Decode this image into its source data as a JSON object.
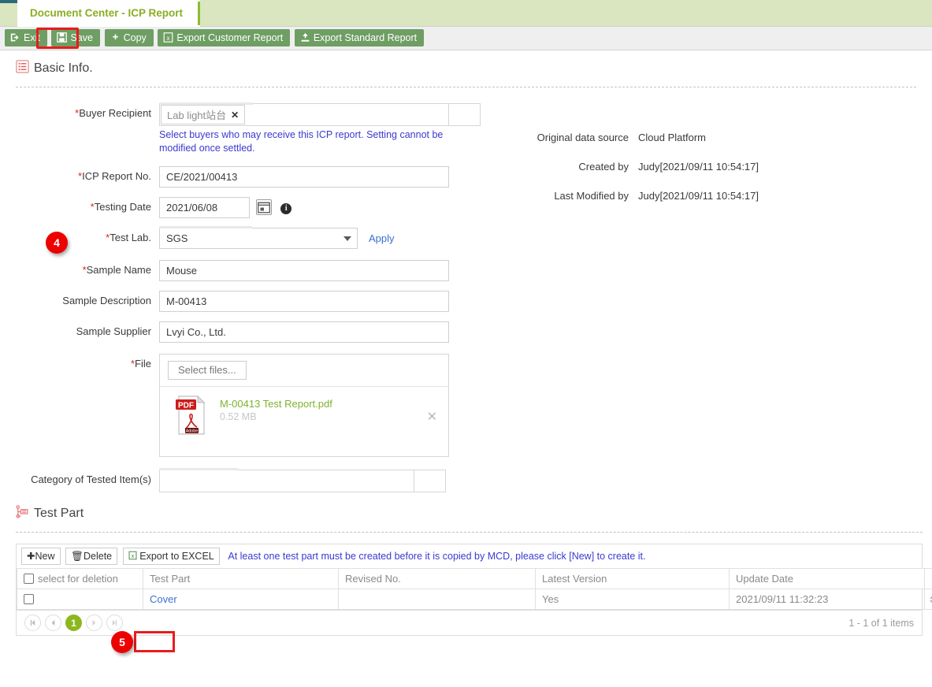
{
  "tab": {
    "title": "Document Center - ICP Report"
  },
  "toolbar": {
    "exit": "Exit",
    "save": "Save",
    "copy": "Copy",
    "export_customer": "Export Customer Report",
    "export_standard": "Export Standard Report"
  },
  "basic_info": {
    "heading": "Basic Info.",
    "buyer_recipient": {
      "label": "Buyer Recipient",
      "required": true,
      "token": "Lab light站台",
      "hint": "Select buyers who may receive this ICP report. Setting cannot be modified once settled."
    },
    "icp_report_no": {
      "label": "ICP Report No.",
      "required": true,
      "value": "CE/2021/00413"
    },
    "testing_date": {
      "label": "Testing Date",
      "required": true,
      "value": "2021/06/08"
    },
    "test_lab": {
      "label": "Test Lab.",
      "required": true,
      "value": "SGS",
      "apply_link": "Apply"
    },
    "sample_name": {
      "label": "Sample Name",
      "required": true,
      "value": "Mouse"
    },
    "sample_description": {
      "label": "Sample Description",
      "required": false,
      "value": "M-00413"
    },
    "sample_supplier": {
      "label": "Sample Supplier",
      "required": false,
      "value": "Lvyi Co., Ltd."
    },
    "file": {
      "label": "File",
      "required": true,
      "select_files": "Select files...",
      "attachment_name": "M-00413 Test Report.pdf",
      "attachment_size": "0.52 MB",
      "icon_label": "PDF",
      "icon_sublabel": "Adobe"
    },
    "category_of_tested_items": {
      "label": "Category of Tested Item(s)",
      "required": false,
      "value": ""
    }
  },
  "meta": [
    {
      "label": "Original data source",
      "value": "Cloud Platform"
    },
    {
      "label": "Created by",
      "value": "Judy[2021/09/11 10:54:17]"
    },
    {
      "label": "Last Modified by",
      "value": "Judy[2021/09/11 10:54:17]"
    }
  ],
  "test_part": {
    "heading": "Test Part",
    "toolbar": {
      "new": "New",
      "delete": "Delete",
      "export_excel": "Export to EXCEL",
      "note": "At least one test part must be created before it is copied by MCD, please click [New] to create it."
    },
    "columns": [
      "select for deletion",
      "Test Part",
      "Revised No.",
      "Latest Version",
      "Update Date"
    ],
    "rows": [
      {
        "test_part": "Cover",
        "revised_no": "",
        "latest_version": "Yes",
        "update_date": "2021/09/11 11:32:23"
      }
    ],
    "pager": {
      "first": "|◀",
      "prev": "◀",
      "current": "1",
      "next": "▶",
      "last": "▶|",
      "items": "1 - 1 of 1 items"
    }
  },
  "annotations": {
    "step4": "4",
    "step5": "5"
  },
  "colors": {
    "tab_text": "#8aae22",
    "toolbar_button": "#6e9e63",
    "highlight": "#e81c1c",
    "link": "#3a6fd0",
    "hint": "#3a3ad0",
    "file_name": "#7db32e",
    "pager_current": "#8cb81e",
    "badge": "#ec0000"
  }
}
